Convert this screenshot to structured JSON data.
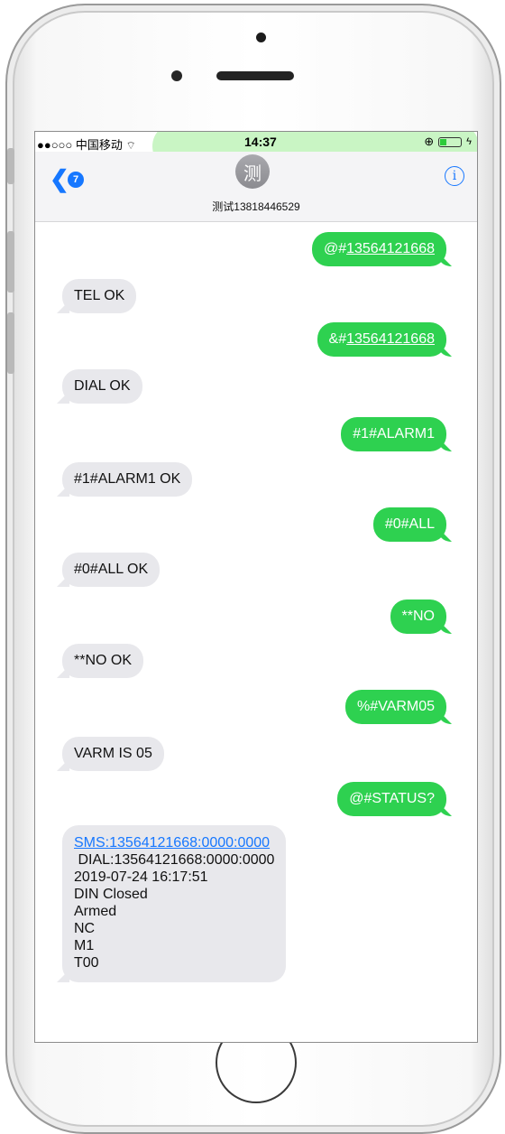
{
  "statusbar": {
    "carrier": "●●○○○ 中国移动",
    "time": "14:37"
  },
  "navbar": {
    "back_count": "7",
    "avatar_char": "测",
    "contact_name": "测试13818446529"
  },
  "messages": [
    {
      "dir": "out",
      "prefix": "@#",
      "link": "13564121668"
    },
    {
      "dir": "in",
      "text": "TEL OK"
    },
    {
      "dir": "out",
      "prefix": "&#",
      "link": "13564121668"
    },
    {
      "dir": "in",
      "text": "DIAL OK"
    },
    {
      "dir": "out",
      "text": "#1#ALARM1"
    },
    {
      "dir": "in",
      "text": "#1#ALARM1 OK"
    },
    {
      "dir": "out",
      "text": "#0#ALL"
    },
    {
      "dir": "in",
      "text": "#0#ALL OK"
    },
    {
      "dir": "out",
      "text": "**NO"
    },
    {
      "dir": "in",
      "text": "**NO OK"
    },
    {
      "dir": "out",
      "text": "%#VARM05"
    },
    {
      "dir": "in",
      "text": "VARM IS 05"
    },
    {
      "dir": "out",
      "text": "@#STATUS?"
    },
    {
      "dir": "in",
      "link": "SMS:13564121668:0000:0000",
      "lines": [
        " DIAL:13564121668:0000:0000",
        "2019-07-24 16:17:51",
        "DIN Closed",
        "Armed",
        "NC",
        "M1",
        "T00"
      ]
    }
  ]
}
